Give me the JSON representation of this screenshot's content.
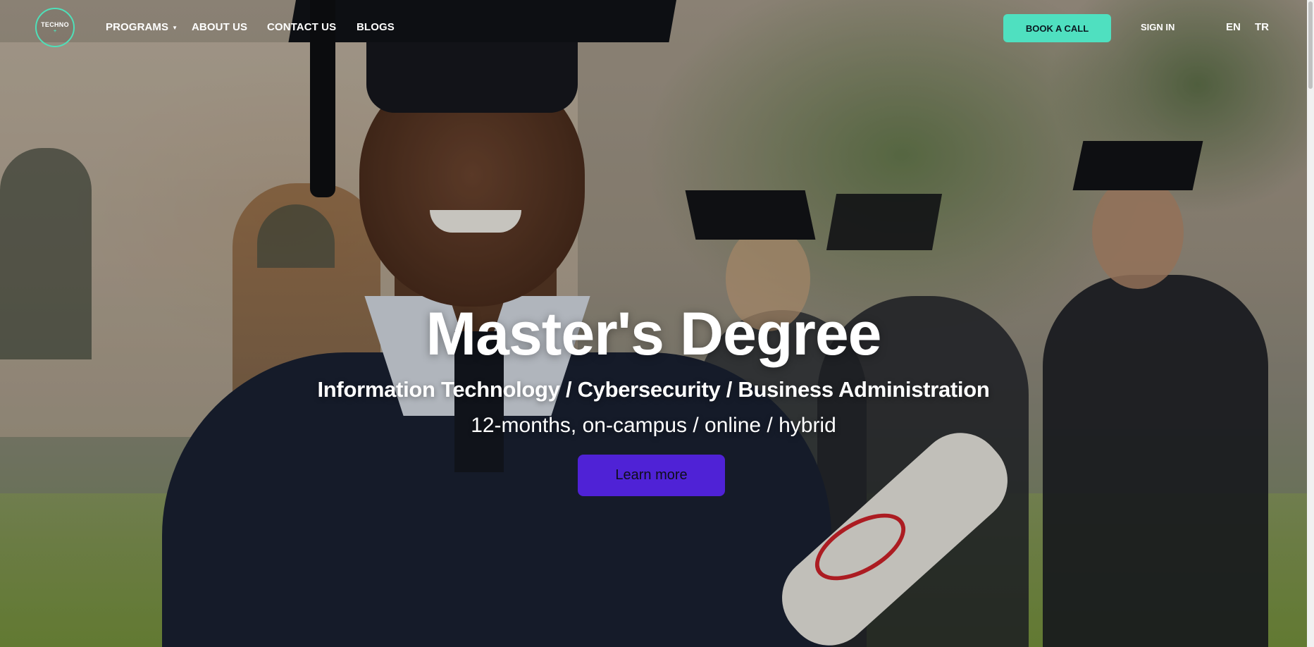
{
  "nav": {
    "logo": {
      "line1": "TECHNO",
      "line2": "+"
    },
    "items": [
      {
        "label": "PROGRAMS",
        "has_dropdown": true
      },
      {
        "label": "ABOUT US"
      },
      {
        "label": "CONTACT US"
      },
      {
        "label": "BLOGS"
      }
    ],
    "book_call": "BOOK A CALL",
    "sign_in": "SIGN IN",
    "languages": [
      "EN",
      "TR"
    ]
  },
  "hero": {
    "title": "Master's Degree",
    "subtitle": "Information Technology / Cybersecurity / Business Administration",
    "description": "12-months, on-campus / online / hybrid",
    "cta": "Learn more"
  },
  "colors": {
    "accent_teal": "#4fe0c0",
    "cta_purple": "#4f22d6"
  }
}
